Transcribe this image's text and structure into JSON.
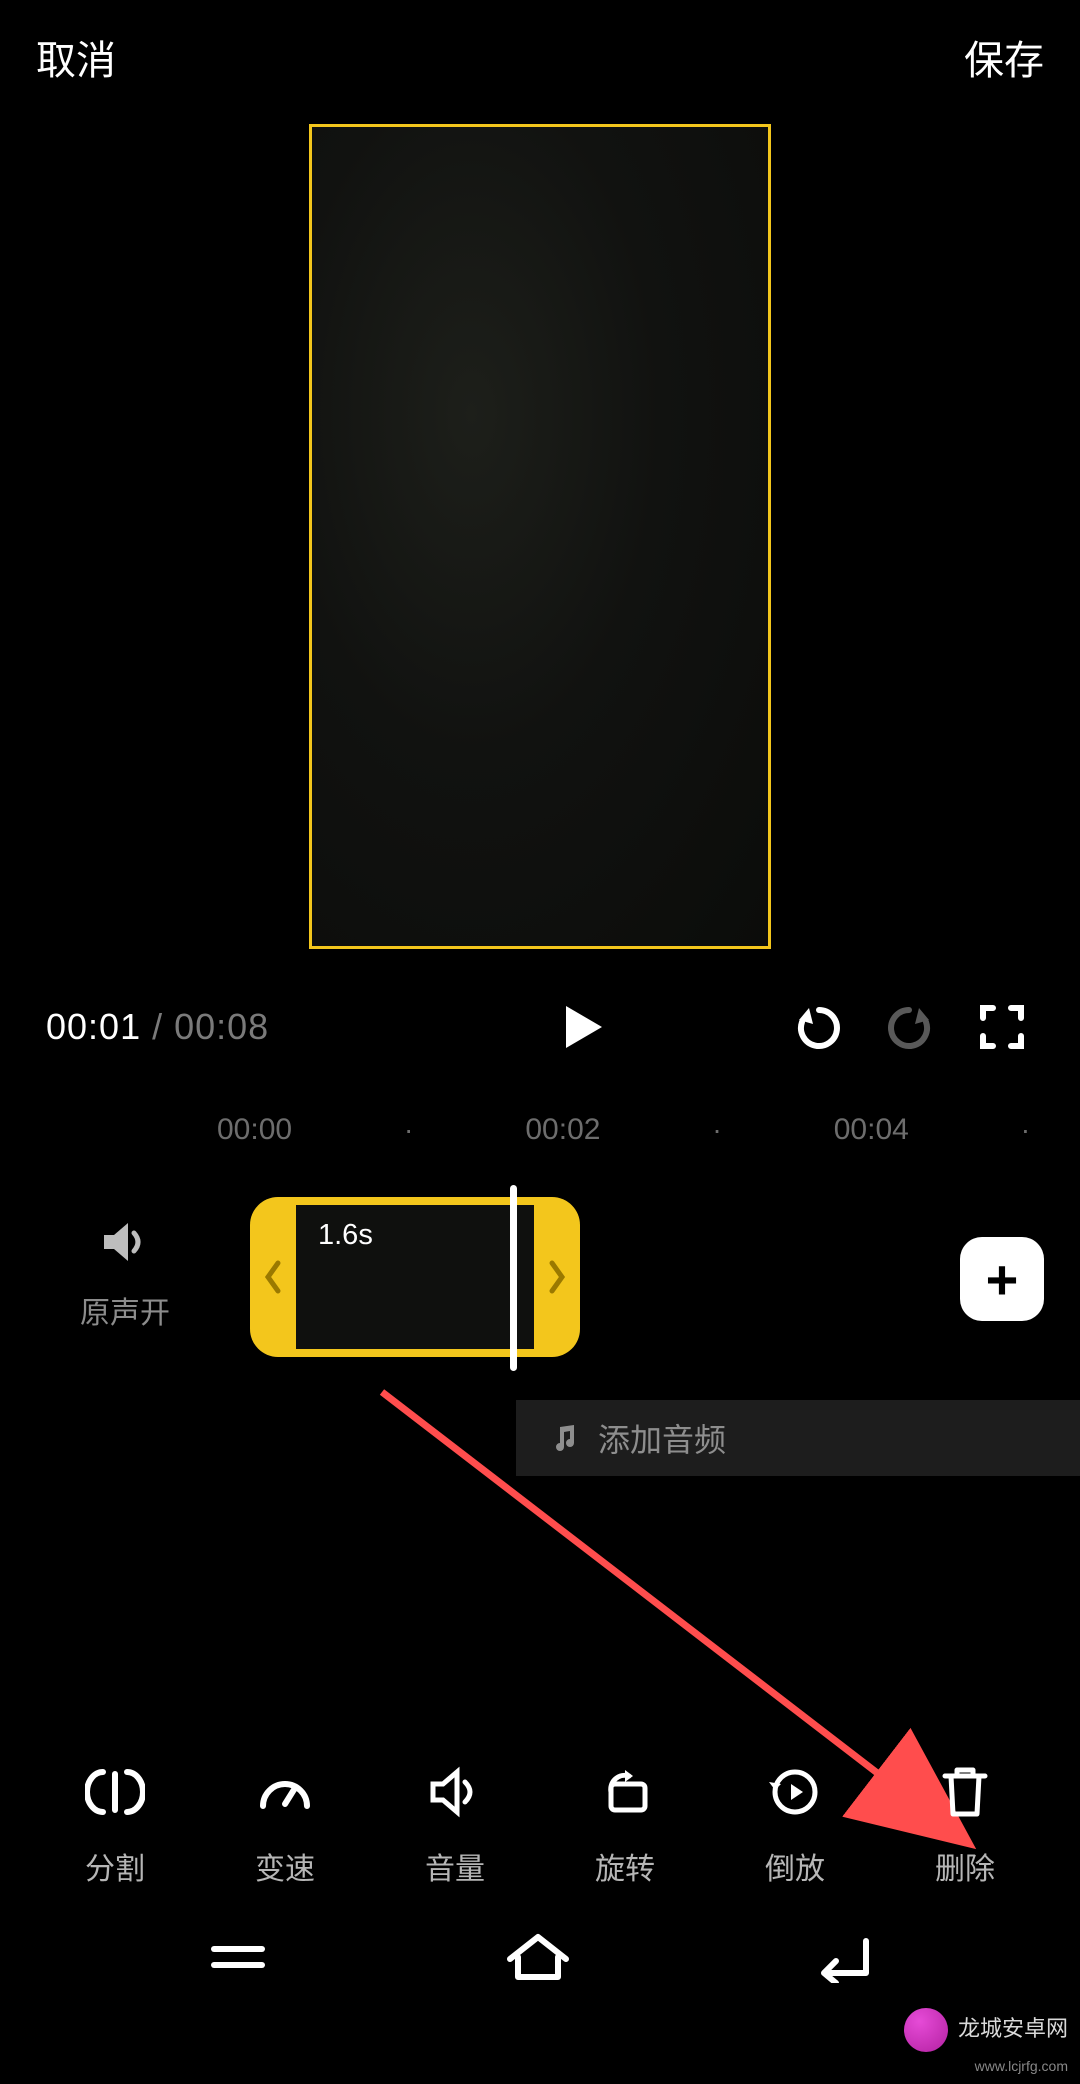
{
  "header": {
    "cancel": "取消",
    "save": "保存"
  },
  "playbar": {
    "current": "00:01",
    "sep": " / ",
    "total": "00:08"
  },
  "ruler": {
    "t0": "00:00",
    "t1": "00:02",
    "t2": "00:04"
  },
  "sound": {
    "label": "原声开"
  },
  "clip": {
    "duration": "1.6s"
  },
  "audio": {
    "add_label": "添加音频"
  },
  "tools": {
    "split": "分割",
    "speed": "变速",
    "volume": "音量",
    "rotate": "旋转",
    "reverse": "倒放",
    "delete": "删除"
  },
  "watermark": {
    "title": "龙城安卓网",
    "sub": "www.lcjrfg.com"
  }
}
